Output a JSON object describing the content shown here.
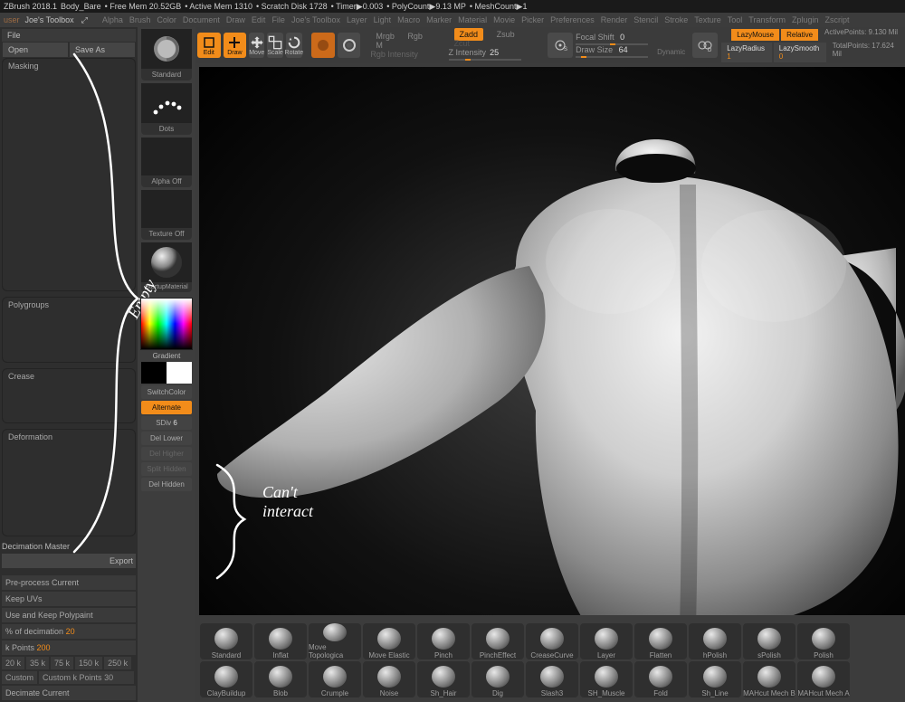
{
  "status": [
    "ZBrush 2018.1",
    "Body_Bare",
    "• Free Mem 20.52GB",
    "• Active Mem 1310",
    "• Scratch Disk 1728",
    "• Timer▶0.003",
    "• PolyCount▶9.13 MP",
    "• MeshCount▶1"
  ],
  "toolbox_title": "Joe's Toolbox",
  "popout_glyph": "⤢",
  "menus": [
    "Alpha",
    "Brush",
    "Color",
    "Document",
    "Draw",
    "Edit",
    "File",
    "Joe's Toolbox",
    "Layer",
    "Light",
    "Macro",
    "Marker",
    "Material",
    "Movie",
    "Picker",
    "Preferences",
    "Render",
    "Stencil",
    "Stroke",
    "Texture",
    "Tool",
    "Transform",
    "Zplugin",
    "Zscript"
  ],
  "file": {
    "hdr": "File",
    "open": "Open",
    "saveas": "Save As"
  },
  "left_panels": [
    "Masking",
    "Polygroups",
    "Crease",
    "Deformation"
  ],
  "decimation": {
    "title": "Decimation Master",
    "export": "Export",
    "items": [
      "Pre-process Current",
      "Keep UVs",
      "Use and Keep Polypaint"
    ],
    "pct_label": "% of decimation",
    "pct_val": "20",
    "kpts_label": "k Points",
    "kpts_val": "200",
    "presets": [
      "20 k",
      "35 k",
      "75 k",
      "150 k",
      "250 k"
    ],
    "custom": "Custom",
    "custom_k_label": "Custom k Points",
    "custom_k_val": "30",
    "decimate": "Decimate Current"
  },
  "toolcol": {
    "brush": "Standard",
    "stroke": "Dots",
    "alpha": "Alpha Off",
    "texture": "Texture Off",
    "material": "StartupMaterial",
    "gradient": "Gradient",
    "switch": "SwitchColor",
    "alternate": "Alternate",
    "sdiv_lbl": "SDiv",
    "sdiv_val": "6",
    "del_lower": "Del Lower",
    "del_higher": "Del Higher",
    "split_hidden": "Split Hidden",
    "del_hidden": "Del Hidden"
  },
  "toolbar": {
    "edit": "Edit",
    "draw": "Draw",
    "move": "Move",
    "scale": "Scale",
    "rotate": "Rotate",
    "mrgb": "Mrgb",
    "rgb": "Rgb",
    "m": "M",
    "rgb_intensity": "Rgb Intensity",
    "zadd": "Zadd",
    "zsub": "Zsub",
    "zcut": "Zcut",
    "zintensity": "Z Intensity",
    "zint_val": "25",
    "focal": "Focal Shift",
    "focal_val": "0",
    "drawsize": "Draw Size",
    "drawsize_val": "64",
    "dynamic": "Dynamic",
    "lazymouse": "LazyMouse",
    "relative": "Relative",
    "lazyradius_l": "LazyRadius",
    "lazyradius_v": "1",
    "lazysmooth_l": "LazySmooth",
    "lazysmooth_v": "0",
    "active_l": "ActivePoints:",
    "active_v": "9.130 Mil",
    "total_l": "TotalPoints:",
    "total_v": "17.624 Mil"
  },
  "brushes_row1": [
    "Standard",
    "Inflat",
    "Move Topologica",
    "Move Elastic",
    "Pinch",
    "PinchEffect",
    "CreaseCurve",
    "Layer",
    "Flatten",
    "hPolish",
    "sPolish",
    "Polish"
  ],
  "brushes_row2": [
    "ClayBuildup",
    "Blob",
    "Crumple",
    "Noise",
    "Sh_Hair",
    "Dig",
    "Slash3",
    "SH_Muscle",
    "Fold",
    "Sh_Line",
    "MAHcut Mech B",
    "MAHcut Mech A"
  ],
  "annotations": {
    "empty": "Empty",
    "cant": "Can't\ninteract"
  }
}
